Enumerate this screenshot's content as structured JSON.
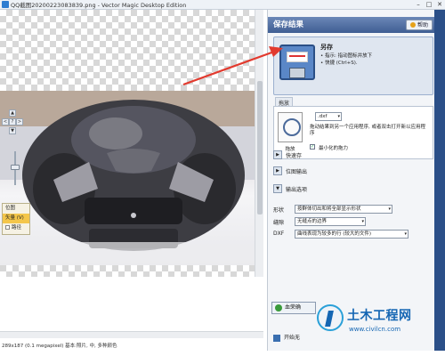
{
  "window": {
    "title": "QQ截图20200223083839.png - Vector Magic Desktop Edition",
    "min": "–",
    "max": "□",
    "close": "✕"
  },
  "canvas": {
    "nav": {
      "up": "▲",
      "down": "▼",
      "left": "<",
      "right": ">",
      "center": "?"
    },
    "view_options": [
      {
        "label": "位图",
        "selected": false
      },
      {
        "label": "矢量 (V)",
        "selected": true
      },
      {
        "label": "路径",
        "selected": false,
        "checkbox": true
      }
    ],
    "status_text": "289x187 (0.1 megapixel)  基本:照片, 中, 多种颜色"
  },
  "panel": {
    "header": "保存结果",
    "help_label": "帮助",
    "save_as": {
      "title": "另存",
      "line1": "• 指示: 指动图标并放下",
      "line2": "• 快捷 (Ctrl+S)."
    },
    "send_section": {
      "label": "拖放",
      "format": ".dxf",
      "description": "拖动结果到另一个应用程序, 或者双击打开新以应用程序",
      "doc_label": "拖放",
      "checkbox_label": "最小化的拖力",
      "checked": true
    },
    "collapse_items": [
      {
        "label": "快速存"
      },
      {
        "label": "位图输出"
      },
      {
        "label": "输出选项"
      }
    ],
    "output_options": {
      "shape_label": "形状",
      "shape_value": "按群体切出和将全部显示形状",
      "gap_label": "缝隙",
      "gap_value": "无缝点的边界",
      "dxf_label": "DXF",
      "dxf_value": "曲线表现为较多的行 (较大的文件)"
    },
    "finish_label": "血荣确",
    "restart_label": "开始无"
  },
  "watermark": {
    "title": "土木工程网",
    "url": "www.civilcn.com"
  },
  "colors": {
    "header_blue": "#3f5e93",
    "arrow_red": "#e23a2e",
    "watermark_blue": "#1566b3"
  }
}
